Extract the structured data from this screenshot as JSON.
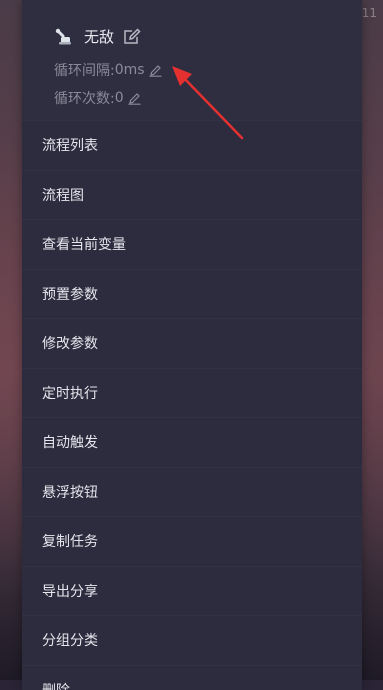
{
  "status_corner": "11",
  "task": {
    "title": "无敌",
    "loop_interval_label": "循环间隔:",
    "loop_interval_value": "0ms",
    "loop_count_label": "循环次数:",
    "loop_count_value": "0"
  },
  "menu": {
    "items": [
      {
        "label": "流程列表"
      },
      {
        "label": "流程图"
      },
      {
        "label": "查看当前变量"
      },
      {
        "label": "预置参数"
      },
      {
        "label": "修改参数"
      },
      {
        "label": "定时执行"
      },
      {
        "label": "自动触发"
      },
      {
        "label": "悬浮按钮"
      },
      {
        "label": "复制任务"
      },
      {
        "label": "导出分享"
      },
      {
        "label": "分组分类"
      },
      {
        "label": "删除"
      }
    ]
  },
  "colors": {
    "panel_bg": "#2c2c3e",
    "arrow": "#e53030",
    "muted_text": "#8a8a9a"
  },
  "icons": {
    "task": "robot-arm-icon",
    "edit": "edit-square-icon",
    "pencil": "pencil-icon"
  }
}
